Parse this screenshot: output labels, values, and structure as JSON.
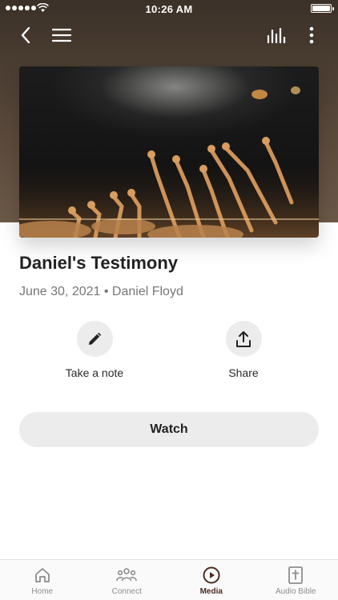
{
  "status_bar": {
    "time": "10:26 AM"
  },
  "colors": {
    "header_brown": "#5a493b",
    "accent_active": "#4a2d20",
    "button_bg": "#ececed"
  },
  "nav": {
    "left_icons": [
      "back-chevron-icon",
      "menu-icon"
    ],
    "right_icons": [
      "equalizer-icon",
      "more-vertical-icon"
    ]
  },
  "media": {
    "title": "Daniel's Testimony",
    "meta": "June 30, 2021 • Daniel Floyd"
  },
  "actions": [
    {
      "label": "Take a note",
      "icon": "pencil-icon"
    },
    {
      "label": "Share",
      "icon": "share-icon"
    }
  ],
  "watch_label": "Watch",
  "tabs": [
    {
      "label": "Home",
      "icon": "home-icon",
      "active": false
    },
    {
      "label": "Connect",
      "icon": "people-icon",
      "active": false
    },
    {
      "label": "Media",
      "icon": "play-circle-icon",
      "active": true
    },
    {
      "label": "Audio Bible",
      "icon": "bible-icon",
      "active": false
    }
  ]
}
